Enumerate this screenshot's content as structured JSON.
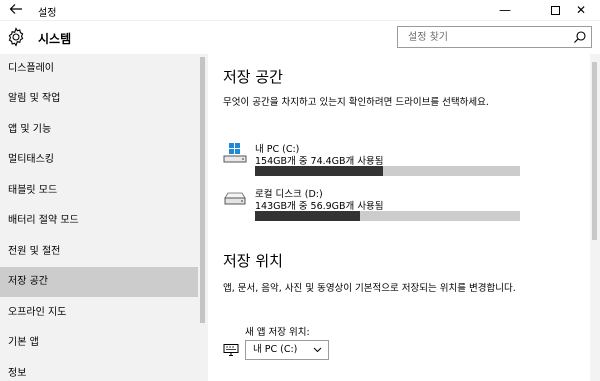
{
  "window": {
    "title": "설정",
    "back_icon": "back-arrow-icon",
    "minimize_glyph": "—",
    "close_glyph": "✕"
  },
  "header": {
    "app_title": "시스템",
    "search_placeholder": "설정 찾기"
  },
  "sidebar": {
    "selected_index": 7,
    "items": [
      {
        "label": "디스플레이"
      },
      {
        "label": "알림 및 작업"
      },
      {
        "label": "앱 및 기능"
      },
      {
        "label": "멀티태스킹"
      },
      {
        "label": "태블릿 모드"
      },
      {
        "label": "배터리 절약 모드"
      },
      {
        "label": "전원 및 절전"
      },
      {
        "label": "저장 공간"
      },
      {
        "label": "오프라인 지도"
      },
      {
        "label": "기본 앱"
      },
      {
        "label": "정보"
      }
    ]
  },
  "storage": {
    "heading": "저장 공간",
    "description": "무엇이 공간을 차지하고 있는지 확인하려면 드라이브를 선택하세요.",
    "drives": [
      {
        "name": "내 PC (C:)",
        "usage": "154GB개 중 74.4GB개 사용됨",
        "icon": "windows-drive-icon",
        "used_gb": 74.4,
        "total_gb": 154
      },
      {
        "name": "로컬 디스크 (D:)",
        "usage": "143GB개 중 56.9GB개 사용됨",
        "icon": "hard-drive-icon",
        "used_gb": 56.9,
        "total_gb": 143
      }
    ]
  },
  "save_locations": {
    "heading": "저장 위치",
    "description": "앱, 문서, 음악, 사진 및 동영상이 기본적으로 저장되는 위치를 변경합니다.",
    "new_apps_label": "새 앱 저장 위치:",
    "new_apps_value": "내 PC (C:)"
  },
  "colors": {
    "selected_nav": "#cccccc",
    "bar_fill": "#333333",
    "bar_track": "#cccccc",
    "windows_blue": "#1c8ad8"
  }
}
